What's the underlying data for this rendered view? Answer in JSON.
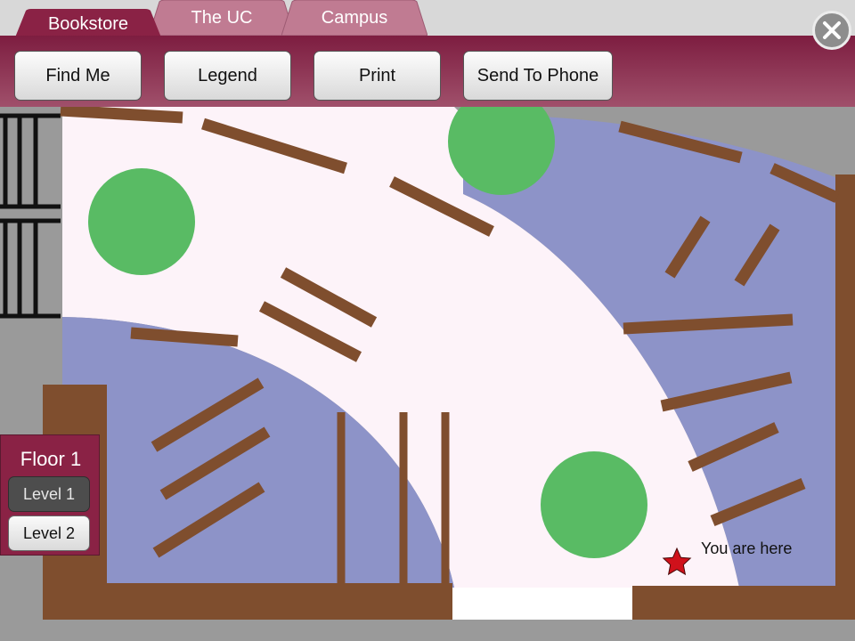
{
  "tabs": [
    {
      "label": "Bookstore",
      "active": true
    },
    {
      "label": "The UC",
      "active": false
    },
    {
      "label": "Campus",
      "active": false
    }
  ],
  "toolbar": {
    "find_me": "Find Me",
    "legend": "Legend",
    "print": "Print",
    "send_to_phone": "Send To Phone"
  },
  "close_icon": "close-icon",
  "floor_panel": {
    "title": "Floor 1",
    "levels": [
      {
        "label": "Level 1",
        "selected": true
      },
      {
        "label": "Level 2",
        "selected": false
      }
    ]
  },
  "map": {
    "marker_label": "You are here",
    "marker_icon": "star-icon",
    "colors": {
      "walkway": "#fdf3f9",
      "zone": "#8d93c8",
      "shelf": "#7f4e2e",
      "plant": "#59bb64",
      "wall": "#7f4e2e",
      "marker": "#d0111b"
    }
  },
  "colors": {
    "brand": "#8a2245",
    "tab_active": "#8a2245",
    "tab_inactive": "#c07b92"
  }
}
